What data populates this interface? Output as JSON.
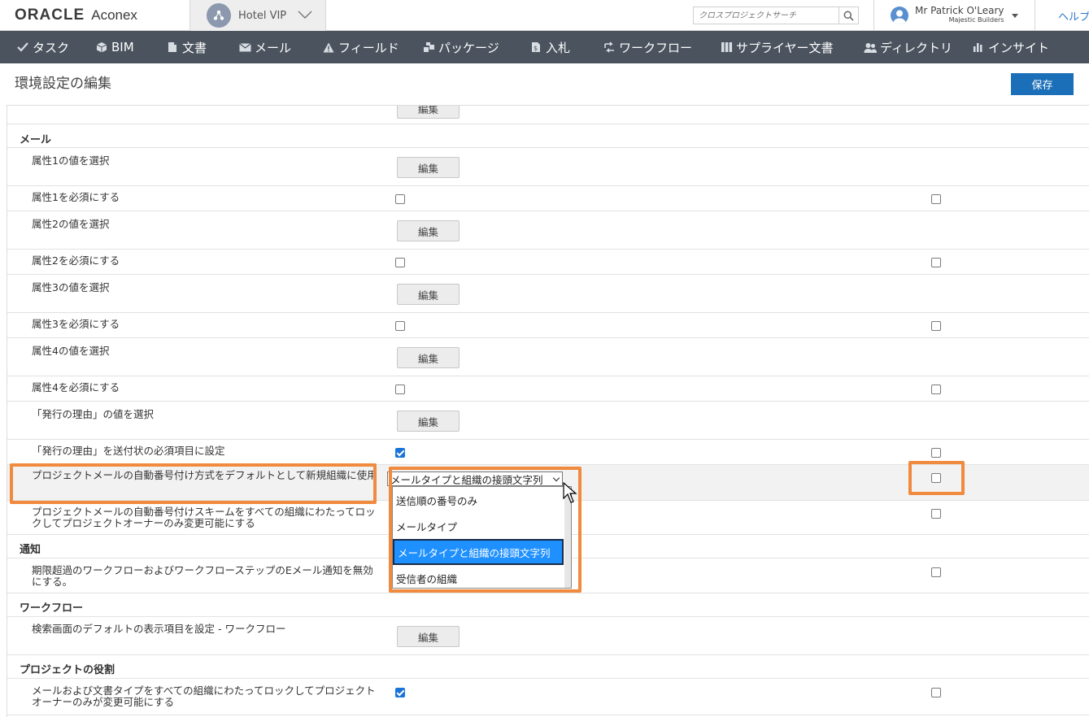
{
  "header": {
    "logo_oracle": "ORACLE",
    "logo_aconex": "Aconex",
    "project_name": "Hotel VIP",
    "search_placeholder": "クロスプロジェクトサーチ",
    "user_name": "Mr Patrick O'Leary",
    "user_org": "Majestic Builders",
    "help_label": "ヘルプ"
  },
  "nav": {
    "items": [
      {
        "label": "タスク",
        "icon": "check-icon"
      },
      {
        "label": "BIM",
        "icon": "cube-icon"
      },
      {
        "label": "文書",
        "icon": "document-icon"
      },
      {
        "label": "メール",
        "icon": "envelope-icon"
      },
      {
        "label": "フィールド",
        "icon": "warning-icon"
      },
      {
        "label": "パッケージ",
        "icon": "package-icon"
      },
      {
        "label": "入札",
        "icon": "tender-icon"
      },
      {
        "label": "ワークフロー",
        "icon": "workflow-icon"
      },
      {
        "label": "サプライヤー文書",
        "icon": "supplier-docs-icon"
      },
      {
        "label": "ディレクトリ",
        "icon": "people-icon"
      },
      {
        "label": "インサイト",
        "icon": "bar-chart-icon"
      }
    ]
  },
  "page": {
    "title": "環境設定の編集",
    "save_label": "保存"
  },
  "content": {
    "top_partial_button": "編集",
    "sections": {
      "mail": "メール",
      "notifications": "通知",
      "workflow": "ワークフロー",
      "project_roles": "プロジェクトの役割"
    },
    "edit_label": "編集",
    "rows": {
      "attr1_values": "属性1の値を選択",
      "attr1_required": "属性1を必須にする",
      "attr2_values": "属性2の値を選択",
      "attr2_required": "属性2を必須にする",
      "attr3_values": "属性3の値を選択",
      "attr3_required": "属性3を必須にする",
      "attr4_values": "属性4の値を選択",
      "attr4_required": "属性4を必須にする",
      "reason_values": "「発行の理由」の値を選択",
      "reason_required": "「発行の理由」を送付状の必須項目に設定",
      "numbering_default": "プロジェクトメールの自動番号付け方式をデフォルトとして新規組織に使用",
      "numbering_lock": "プロジェクトメールの自動番号付けスキームをすべての組織にわたってロックしてプロジェクトオーナーのみ変更可能にする",
      "overdue_notify": "期限超過のワークフローおよびワークフローステップのEメール通知を無効にする。",
      "workflow_search_default": "検索画面のデフォルトの表示項目を設定 - ワークフロー",
      "mail_doc_type_lock": "メールおよび文書タイプをすべての組織にわたってロックしてプロジェクトオーナーのみが変更可能にする"
    },
    "checkboxes": {
      "attr1_required_col1": false,
      "attr1_required_col2": false,
      "attr2_required_col1": false,
      "attr2_required_col2": false,
      "attr3_required_col1": false,
      "attr3_required_col2": false,
      "attr4_required_col1": false,
      "attr4_required_col2": false,
      "reason_required_col1": true,
      "reason_required_col2": false,
      "numbering_default_col2": false,
      "numbering_lock_col2": false,
      "overdue_notify_col2": false,
      "mail_doc_type_lock_col1": true,
      "mail_doc_type_lock_col2": false
    },
    "numbering_select": {
      "selected": "メールタイプと組織の接頭文字列",
      "options": [
        "送信順の番号のみ",
        "メールタイプ",
        "メールタイプと組織の接頭文字列",
        "受信者の組織"
      ],
      "highlighted_index": 2
    }
  },
  "colors": {
    "nav_bg": "#4a535e",
    "accent_blue": "#1b6fb8",
    "annotation_orange": "#f08a3e",
    "option_highlight": "#1e90ff"
  }
}
